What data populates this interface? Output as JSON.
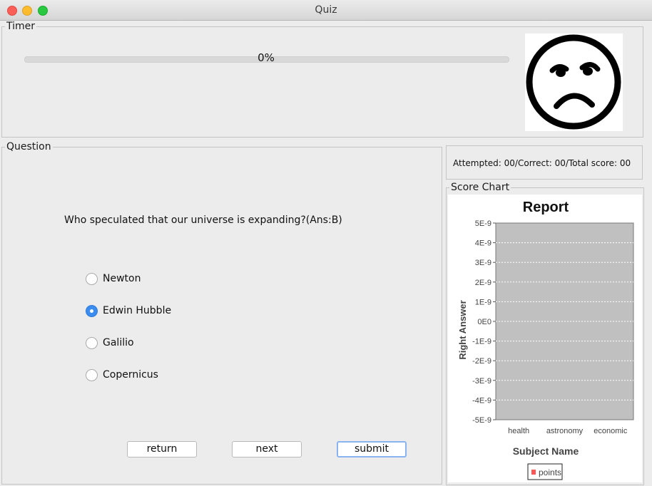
{
  "window": {
    "title": "Quiz"
  },
  "timer": {
    "legend": "Timer",
    "progress_text": "0%",
    "progress_fraction": 0.0,
    "face_icon": "sad-face-icon"
  },
  "question_panel": {
    "legend": "Question",
    "question": "Who speculated that our universe is expanding?(Ans:B)",
    "options": [
      {
        "label": "Newton",
        "selected": false
      },
      {
        "label": "Edwin Hubble",
        "selected": true
      },
      {
        "label": "Galilio",
        "selected": false
      },
      {
        "label": "Copernicus",
        "selected": false
      }
    ],
    "buttons": {
      "return_label": "return",
      "next_label": "next",
      "submit_label": "submit"
    }
  },
  "score": {
    "text": "Attempted: 00/Correct: 00/Total score: 00"
  },
  "score_chart": {
    "legend": "Score Chart",
    "chart_data": {
      "type": "bar",
      "title": "Report",
      "xlabel": "Subject Name",
      "ylabel": "Right Answer",
      "categories": [
        "health",
        "astronomy",
        "economic"
      ],
      "series": [
        {
          "name": "points",
          "values": [
            0,
            0,
            0
          ],
          "color": "#ff5555"
        }
      ],
      "yticks": [
        "5E-9",
        "4E-9",
        "3E-9",
        "2E-9",
        "1E-9",
        "0E0",
        "-1E-9",
        "-2E-9",
        "-3E-9",
        "-4E-9",
        "-5E-9"
      ],
      "ylim": [
        -5e-09,
        5e-09
      ],
      "grid": true,
      "legend_position": "bottom",
      "plot_background": "#c0c0c0"
    }
  }
}
